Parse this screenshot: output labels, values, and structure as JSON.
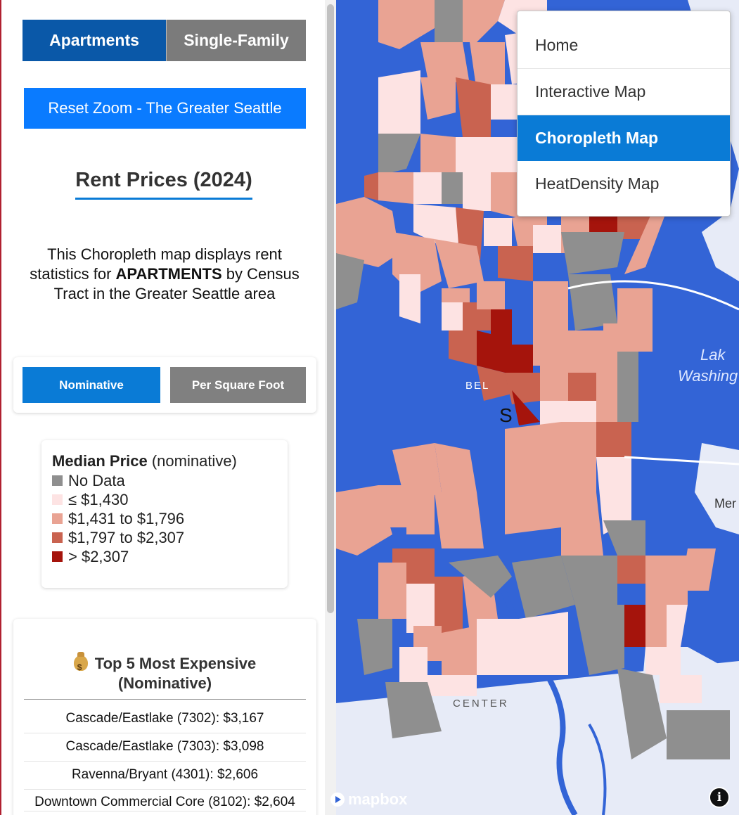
{
  "property_toggle": {
    "apartments": "Apartments",
    "single_family": "Single-Family"
  },
  "reset_zoom": "Reset Zoom - The Greater Seattle",
  "title": "Rent Prices (2024)",
  "description": {
    "part1": "This Choropleth map displays rent statistics for ",
    "bold": "APARTMENTS",
    "part2": " by Census Tract in the Greater Seattle area"
  },
  "metric_toggle": {
    "nominative": "Nominative",
    "per_sqft": "Per Square Foot"
  },
  "legend": {
    "title_bold": "Median Price",
    "title_rest": " (nominative)",
    "items": [
      {
        "label": "No Data",
        "color": "#8f8f8f"
      },
      {
        "label": "≤ $1,430",
        "color": "#fde3e3"
      },
      {
        "label": "$1,431 to $1,796",
        "color": "#e9a393"
      },
      {
        "label": "$1,797 to $2,307",
        "color": "#c96350"
      },
      {
        "label": "> $2,307",
        "color": "#a5140c"
      }
    ]
  },
  "top5": {
    "icon": "money-bag-icon",
    "title_line1": "Top 5 Most Expensive",
    "title_line2": "(Nominative)",
    "items": [
      "Cascade/Eastlake (7302): $3,167",
      "Cascade/Eastlake (7303): $3,098",
      "Ravenna/Bryant (4301): $2,606",
      "Downtown Commercial Core (8102): $2,604"
    ]
  },
  "nav": {
    "items": [
      {
        "label": "Home",
        "active": false
      },
      {
        "label": "Interactive Map",
        "active": false
      },
      {
        "label": "Choropleth Map",
        "active": true
      },
      {
        "label": "HeatDensity Map",
        "active": false
      }
    ]
  },
  "map_labels": {
    "lake1": "Lak",
    "lake2": "Washing",
    "belltown": "BEL",
    "seattle": "S",
    "mercer": "Mer",
    "center": "CENTER"
  },
  "attribution": "mapbox",
  "info": "i",
  "colors": {
    "water": "#3364d6",
    "land": "#e7ebf7",
    "accent": "#0a7bd6",
    "brand": "#0a58a8"
  }
}
